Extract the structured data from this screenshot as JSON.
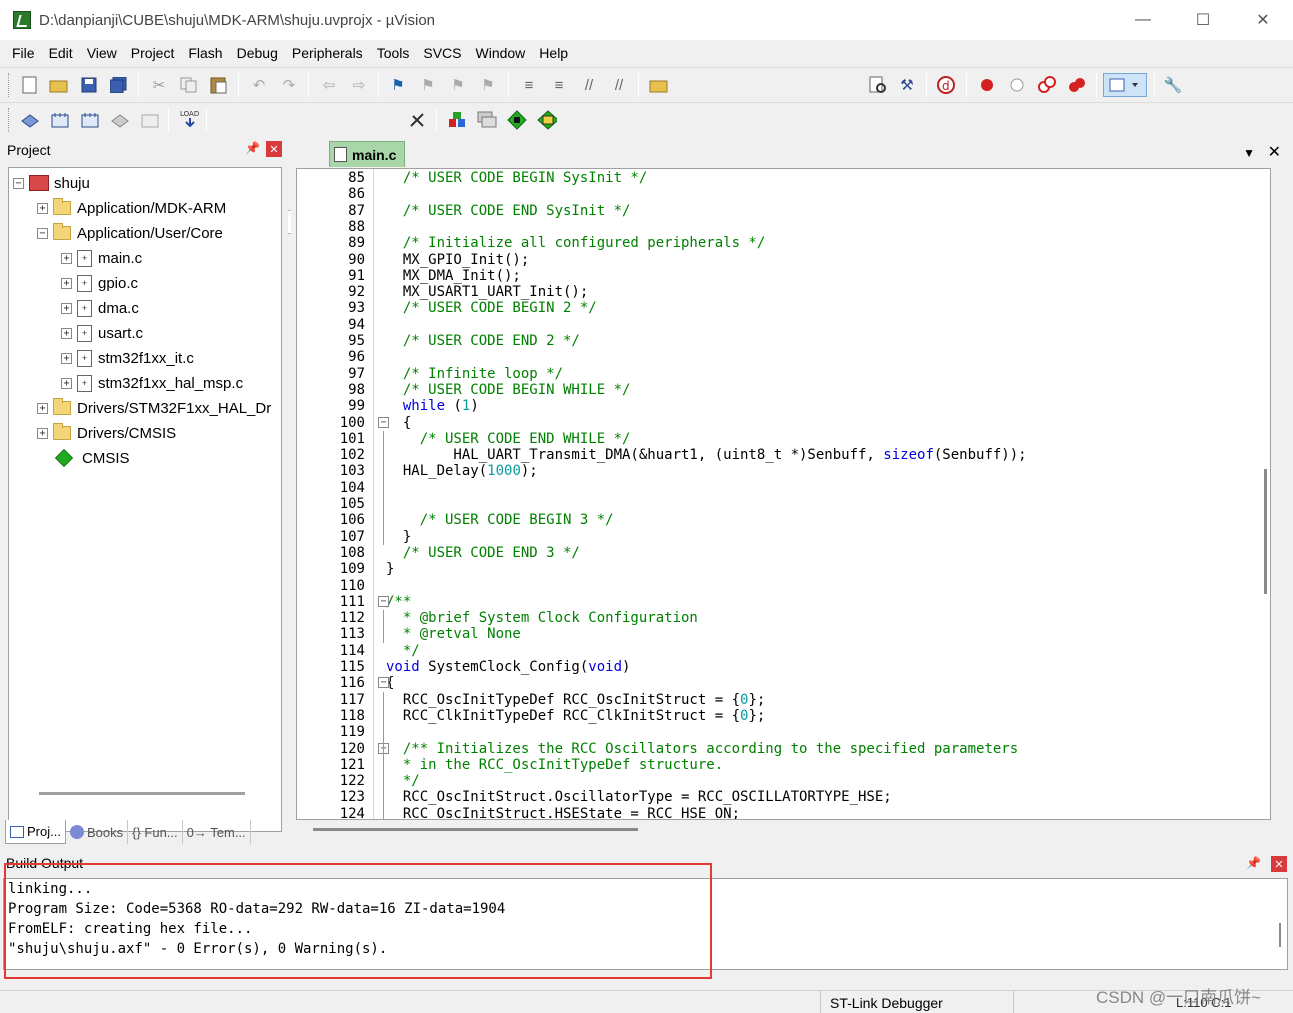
{
  "window": {
    "title": "D:\\danpianji\\CUBE\\shuju\\MDK-ARM\\shuju.uvprojx - µVision",
    "minimize": "—",
    "maximize": "☐",
    "close": "✕"
  },
  "menu": [
    "File",
    "Edit",
    "View",
    "Project",
    "Flash",
    "Debug",
    "Peripherals",
    "Tools",
    "SVCS",
    "Window",
    "Help"
  ],
  "toolbar": {
    "target": "shuju"
  },
  "project_panel": {
    "title": "Project",
    "tree": {
      "root": "shuju",
      "groups": [
        "Application/MDK-ARM",
        "Application/User/Core",
        "Drivers/STM32F1xx_HAL_Dr",
        "Drivers/CMSIS",
        "CMSIS"
      ],
      "files": [
        "main.c",
        "gpio.c",
        "dma.c",
        "usart.c",
        "stm32f1xx_it.c",
        "stm32f1xx_hal_msp.c"
      ]
    },
    "tabs": [
      "Proj...",
      "Books",
      "{} Fun...",
      "0→ Tem..."
    ]
  },
  "editor": {
    "active_tab": "main.c",
    "lines": [
      {
        "n": "85",
        "t": "  /* USER CODE BEGIN SysInit */"
      },
      {
        "n": "86",
        "t": ""
      },
      {
        "n": "87",
        "t": "  /* USER CODE END SysInit */"
      },
      {
        "n": "88",
        "t": ""
      },
      {
        "n": "89",
        "t": "  /* Initialize all configured peripherals */"
      },
      {
        "n": "90",
        "t": "  MX_GPIO_Init();"
      },
      {
        "n": "91",
        "t": "  MX_DMA_Init();"
      },
      {
        "n": "92",
        "t": "  MX_USART1_UART_Init();"
      },
      {
        "n": "93",
        "t": "  /* USER CODE BEGIN 2 */"
      },
      {
        "n": "94",
        "t": ""
      },
      {
        "n": "95",
        "t": "  /* USER CODE END 2 */"
      },
      {
        "n": "96",
        "t": ""
      },
      {
        "n": "97",
        "t": "  /* Infinite loop */"
      },
      {
        "n": "98",
        "t": "  /* USER CODE BEGIN WHILE */"
      },
      {
        "n": "99",
        "t": "  while (1)"
      },
      {
        "n": "100",
        "t": "  {"
      },
      {
        "n": "101",
        "t": "    /* USER CODE END WHILE */"
      },
      {
        "n": "102",
        "t": "        HAL_UART_Transmit_DMA(&huart1, (uint8_t *)Senbuff, sizeof(Senbuff));"
      },
      {
        "n": "103",
        "t": "  HAL_Delay(1000);"
      },
      {
        "n": "104",
        "t": ""
      },
      {
        "n": "105",
        "t": ""
      },
      {
        "n": "106",
        "t": "    /* USER CODE BEGIN 3 */"
      },
      {
        "n": "107",
        "t": "  }"
      },
      {
        "n": "108",
        "t": "  /* USER CODE END 3 */"
      },
      {
        "n": "109",
        "t": "}"
      },
      {
        "n": "110",
        "t": ""
      },
      {
        "n": "111",
        "t": "/**"
      },
      {
        "n": "112",
        "t": "  * @brief System Clock Configuration"
      },
      {
        "n": "113",
        "t": "  * @retval None"
      },
      {
        "n": "114",
        "t": "  */"
      },
      {
        "n": "115",
        "t": "void SystemClock_Config(void)"
      },
      {
        "n": "116",
        "t": "{"
      },
      {
        "n": "117",
        "t": "  RCC_OscInitTypeDef RCC_OscInitStruct = {0};"
      },
      {
        "n": "118",
        "t": "  RCC_ClkInitTypeDef RCC_ClkInitStruct = {0};"
      },
      {
        "n": "119",
        "t": ""
      },
      {
        "n": "120",
        "t": "  /** Initializes the RCC Oscillators according to the specified parameters"
      },
      {
        "n": "121",
        "t": "  * in the RCC_OscInitTypeDef structure."
      },
      {
        "n": "122",
        "t": "  */"
      },
      {
        "n": "123",
        "t": "  RCC_OscInitStruct.OscillatorType = RCC_OSCILLATORTYPE_HSE;"
      },
      {
        "n": "124",
        "t": "  RCC_OscInitStruct.HSEState = RCC_HSE_ON;"
      }
    ]
  },
  "build_output": {
    "title": "Build Output",
    "lines": [
      "linking...",
      "Program Size: Code=5368 RO-data=292 RW-data=16 ZI-data=1904",
      "FromELF: creating hex file...",
      "\"shuju\\shuju.axf\" - 0 Error(s), 0 Warning(s)."
    ]
  },
  "status": {
    "debugger": "ST-Link Debugger",
    "position": "L:110 C:1",
    "watermark": "CSDN @一口南瓜饼~"
  },
  "colors": {
    "comment": "#008000",
    "keyword": "#0000e0",
    "number": "#0a9a9a",
    "active_tab": "#a8d6a8",
    "highlight_box": "#e53935"
  }
}
